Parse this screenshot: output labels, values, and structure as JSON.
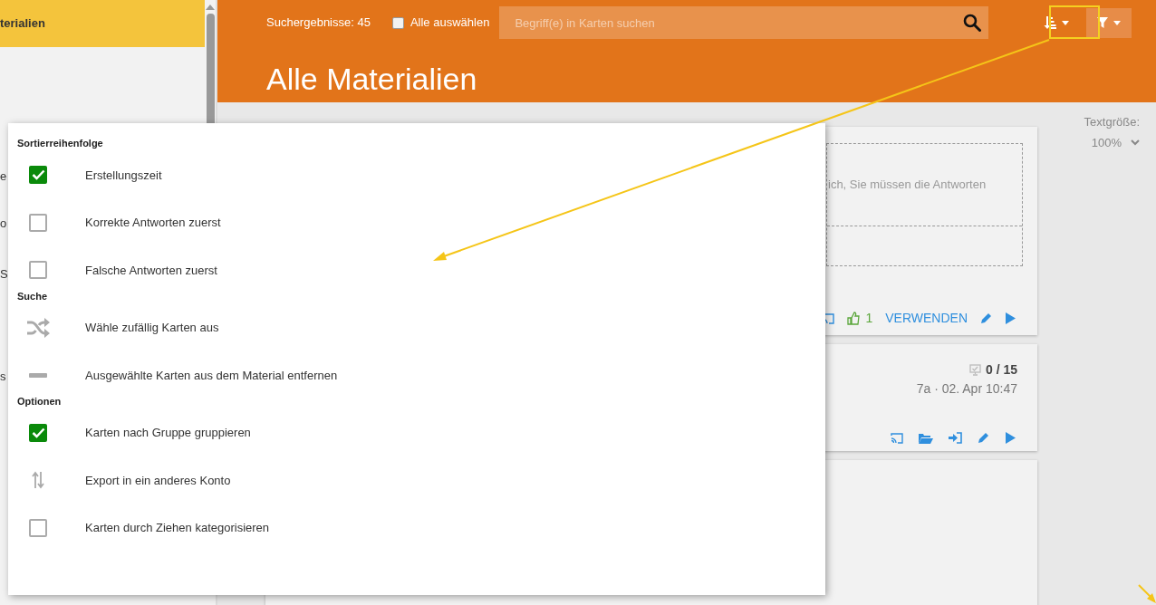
{
  "sidebar": {
    "items": [
      {
        "label": "terialien",
        "selected": true
      },
      {
        "label": "e",
        "selected": false
      },
      {
        "label": "o",
        "selected": false
      },
      {
        "label": "S",
        "selected": false
      },
      {
        "label": "s",
        "selected": false
      }
    ]
  },
  "header": {
    "result_count": "Suchergebnisse: 45",
    "select_all": {
      "label": "Alle auswählen",
      "checked": false
    },
    "search": {
      "placeholder": "Begriff(e) in Karten suchen"
    },
    "title": "Alle Materialien"
  },
  "text_size": {
    "label": "Textgröße:",
    "value": "100%"
  },
  "cards": [
    {
      "kind": "shared",
      "body": "ich, Sie müssen die Antworten",
      "likes": "1",
      "use_label": "VERWENDEN"
    },
    {
      "kind": "own",
      "score": "0 / 15",
      "meta": "7a · 02. Apr 10:47"
    },
    {
      "kind": "empty"
    }
  ],
  "menu": {
    "sections": [
      {
        "title": "Sortierreihenfolge",
        "items": [
          {
            "kind": "checkbox",
            "label": "Erstellungszeit",
            "checked": true
          },
          {
            "kind": "checkbox",
            "label": "Korrekte Antworten zuerst",
            "checked": false
          },
          {
            "kind": "checkbox",
            "label": "Falsche Antworten zuerst",
            "checked": false
          }
        ]
      },
      {
        "title": "Suche",
        "items": [
          {
            "kind": "shuffle",
            "label": "Wähle zufällig Karten aus"
          },
          {
            "kind": "remove",
            "label": "Ausgewählte Karten aus dem Material entfernen"
          }
        ]
      },
      {
        "title": "Optionen",
        "items": [
          {
            "kind": "checkbox",
            "label": "Karten nach Gruppe gruppieren",
            "checked": true
          },
          {
            "kind": "transfer",
            "label": "Export in ein anderes Konto"
          },
          {
            "kind": "checkbox",
            "label": "Karten durch Ziehen kategorisieren",
            "checked": false
          }
        ]
      }
    ]
  }
}
